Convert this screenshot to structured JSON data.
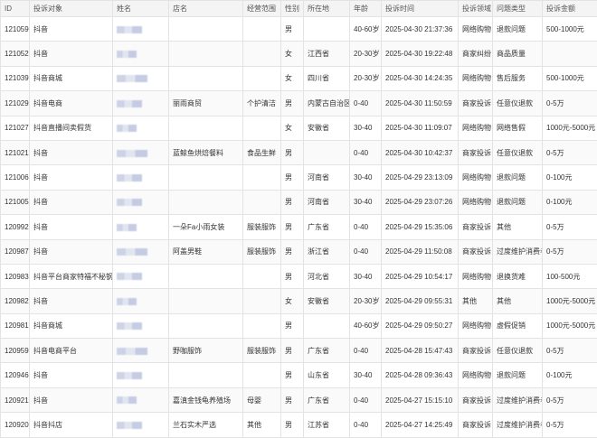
{
  "columns": [
    "ID",
    "投诉对象",
    "姓名",
    "店名",
    "经营范围",
    "性别",
    "所在地",
    "年龄",
    "投诉时间",
    "投诉领域",
    "问题类型",
    "投诉金额"
  ],
  "rows": [
    {
      "id": "121059",
      "target": "抖音",
      "shop": "",
      "scope": "",
      "gender": "男",
      "location": "",
      "age": "40-60岁",
      "time": "2025-04-30 21:37:36",
      "domain": "网络购物",
      "issue": "退款问题",
      "amount": "500-1000元"
    },
    {
      "id": "121052",
      "target": "抖音",
      "shop": "",
      "scope": "",
      "gender": "女",
      "location": "江西省",
      "age": "20-30岁",
      "time": "2025-04-30 19:22:48",
      "domain": "商家纠纷",
      "issue": "商品质量",
      "amount": ""
    },
    {
      "id": "121039",
      "target": "抖音商城",
      "shop": "",
      "scope": "",
      "gender": "女",
      "location": "四川省",
      "age": "20-30岁",
      "time": "2025-04-30 14:24:35",
      "domain": "网络购物",
      "issue": "售后服务",
      "amount": "500-1000元"
    },
    {
      "id": "121029",
      "target": "抖音电商",
      "shop": "丽雨商贸",
      "scope": "个护清洁",
      "gender": "男",
      "location": "内蒙古自治区",
      "age": "0-40",
      "time": "2025-04-30 11:50:59",
      "domain": "商家投诉",
      "issue": "任意仪退款",
      "amount": "0-5万"
    },
    {
      "id": "121027",
      "target": "抖音直播间卖假货",
      "shop": "",
      "scope": "",
      "gender": "女",
      "location": "安徽省",
      "age": "30-40",
      "time": "2025-04-30 11:09:07",
      "domain": "网络购物",
      "issue": "网络售假",
      "amount": "1000元-5000元"
    },
    {
      "id": "121021",
      "target": "抖音",
      "shop": "蓝鲸鱼烘焙餐料",
      "scope": "食品生鲜",
      "gender": "男",
      "location": "",
      "age": "0-40",
      "time": "2025-04-30 10:42:37",
      "domain": "商家投诉",
      "issue": "任意仪退款",
      "amount": "0-5万"
    },
    {
      "id": "121006",
      "target": "抖音",
      "shop": "",
      "scope": "",
      "gender": "男",
      "location": "河南省",
      "age": "30-40",
      "time": "2025-04-29 23:13:09",
      "domain": "网络购物",
      "issue": "退款问题",
      "amount": "0-100元"
    },
    {
      "id": "121005",
      "target": "抖音",
      "shop": "",
      "scope": "",
      "gender": "男",
      "location": "河南省",
      "age": "30-40",
      "time": "2025-04-29 23:07:26",
      "domain": "网络购物",
      "issue": "退款问题",
      "amount": "0-100元"
    },
    {
      "id": "120992",
      "target": "抖音",
      "shop": "一朵Fa小雨女装",
      "scope": "服装服饰",
      "gender": "男",
      "location": "广东省",
      "age": "0-40",
      "time": "2025-04-29 15:35:06",
      "domain": "商家投诉",
      "issue": "其他",
      "amount": "0-5万"
    },
    {
      "id": "120987",
      "target": "抖音",
      "shop": "阿盖男鞋",
      "scope": "服装服饰",
      "gender": "男",
      "location": "浙江省",
      "age": "0-40",
      "time": "2025-04-29 11:50:08",
      "domain": "商家投诉",
      "issue": "过度维护消费者",
      "amount": "0-5万"
    },
    {
      "id": "120983",
      "target": "抖音平台商家特福不秘钢",
      "shop": "",
      "scope": "",
      "gender": "男",
      "location": "河北省",
      "age": "30-40",
      "time": "2025-04-29 10:54:17",
      "domain": "网络购物",
      "issue": "退换货难",
      "amount": "100-500元"
    },
    {
      "id": "120982",
      "target": "抖音",
      "shop": "",
      "scope": "",
      "gender": "女",
      "location": "安徽省",
      "age": "20-30岁",
      "time": "2025-04-29 09:55:31",
      "domain": "其他",
      "issue": "其他",
      "amount": "1000元-5000元"
    },
    {
      "id": "120981",
      "target": "抖音商城",
      "shop": "",
      "scope": "",
      "gender": "男",
      "location": "",
      "age": "40-60岁",
      "time": "2025-04-29 09:50:27",
      "domain": "网络购物",
      "issue": "虚假促销",
      "amount": "1000元-5000元"
    },
    {
      "id": "120959",
      "target": "抖音电商平台",
      "shop": "野咖服饰",
      "scope": "服装服饰",
      "gender": "男",
      "location": "广东省",
      "age": "0-40",
      "time": "2025-04-28 15:47:43",
      "domain": "商家投诉",
      "issue": "任意仪退款",
      "amount": "0-5万"
    },
    {
      "id": "120946",
      "target": "抖音",
      "shop": "",
      "scope": "",
      "gender": "男",
      "location": "山东省",
      "age": "30-40",
      "time": "2025-04-28 09:36:43",
      "domain": "网络购物",
      "issue": "退款问题",
      "amount": "0-100元"
    },
    {
      "id": "120921",
      "target": "抖音",
      "shop": "嘉滇金钱龟养殖场",
      "scope": "母婴",
      "gender": "男",
      "location": "广东省",
      "age": "0-40",
      "time": "2025-04-27 15:15:10",
      "domain": "商家投诉",
      "issue": "过度维护消费者",
      "amount": "0-5万"
    },
    {
      "id": "120920",
      "target": "抖音抖店",
      "shop": "兰石实木严选",
      "scope": "其他",
      "gender": "男",
      "location": "江苏省",
      "age": "0-40",
      "time": "2025-04-27 14:25:49",
      "domain": "商家投诉",
      "issue": "过度维护消费者",
      "amount": "0-5万"
    }
  ]
}
